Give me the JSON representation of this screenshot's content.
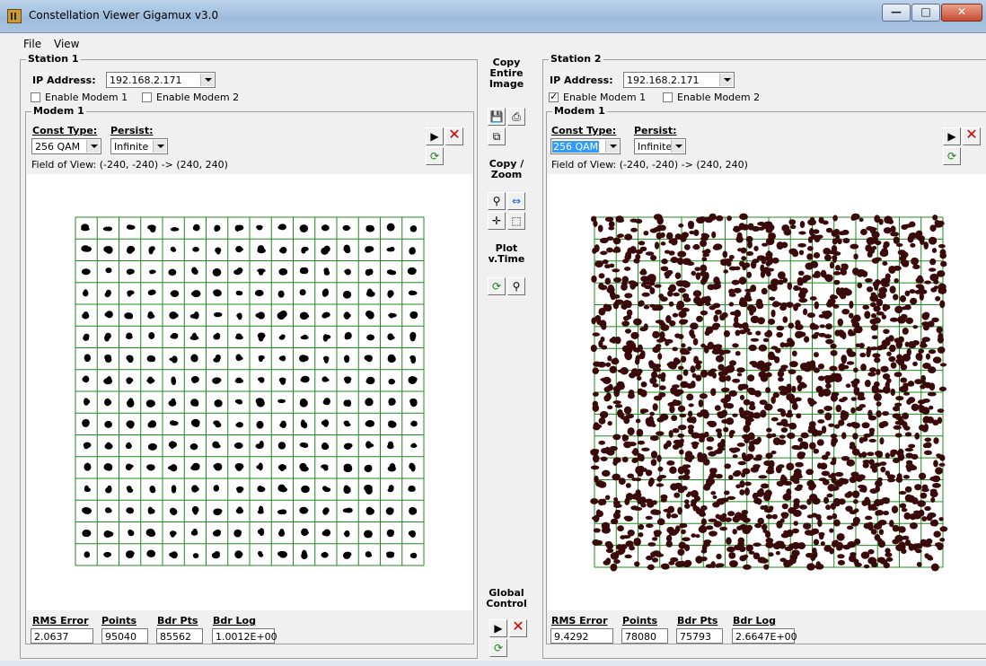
{
  "window": {
    "title": "Constellation Viewer Gigamux v3.0"
  },
  "menu": {
    "file": "File",
    "view": "View"
  },
  "station1": {
    "title": "Station 1",
    "ip_label": "IP Address:",
    "ip_value": "192.168.2.171",
    "modem1_checkbox": "Enable Modem 1",
    "modem1_checked": false,
    "modem2_checkbox": "Enable Modem 2",
    "modem2_checked": false,
    "modem": {
      "title": "Modem 1",
      "const_type_label": "Const Type:",
      "const_type_value": "256 QAM",
      "persist_label": "Persist:",
      "persist_value": "Infinite",
      "field_of_view": "Field of View: (-240, -240) -> (240, 240)"
    },
    "stats": {
      "rms_label": "RMS Error",
      "rms_value": "2.0637",
      "points_label": "Points",
      "points_value": "95040",
      "bdr_pts_label": "Bdr Pts",
      "bdr_pts_value": "85562",
      "bdr_log_label": "Bdr Log",
      "bdr_log_value": "1.0012E+00"
    }
  },
  "station2": {
    "title": "Station 2",
    "ip_label": "IP Address:",
    "ip_value": "192.168.2.171",
    "modem1_checkbox": "Enable Modem 1",
    "modem1_checked": true,
    "modem2_checkbox": "Enable Modem 2",
    "modem2_checked": false,
    "modem": {
      "title": "Modem 1",
      "const_type_label": "Const Type:",
      "const_type_value": "256 QAM",
      "persist_label": "Persist:",
      "persist_value": "Infinite",
      "field_of_view": "Field of View: (-240, -240) -> (240, 240)"
    },
    "stats": {
      "rms_label": "RMS Error",
      "rms_value": "9.4292",
      "points_label": "Points",
      "points_value": "78080",
      "bdr_pts_label": "Bdr Pts",
      "bdr_pts_value": "75793",
      "bdr_log_label": "Bdr Log",
      "bdr_log_value": "2.6647E+00"
    }
  },
  "center": {
    "copy_label": "Copy Entire Image",
    "copy_zoom_label": "Copy / Zoom",
    "plot_time_label": "Plot v.Time",
    "global_label": "Global Control"
  },
  "colors": {
    "grid": "#1e8c1e",
    "dots": "#000000",
    "dots2": "#3a0a0a"
  }
}
